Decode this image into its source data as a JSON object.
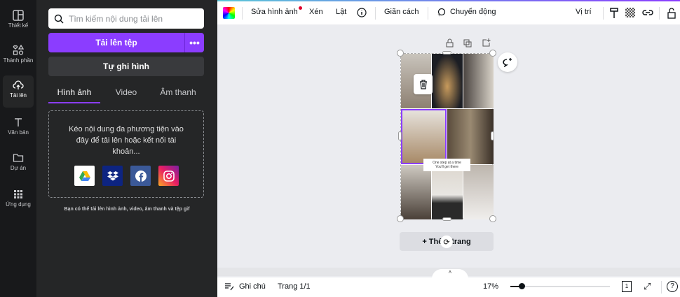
{
  "rail": {
    "items": [
      {
        "label": "Thiết kế",
        "icon": "layout-icon"
      },
      {
        "label": "Thành phần",
        "icon": "elements-icon"
      },
      {
        "label": "Tải lên",
        "icon": "cloud-upload-icon",
        "active": true
      },
      {
        "label": "Văn bản",
        "icon": "text-icon"
      },
      {
        "label": "Dự án",
        "icon": "folder-icon"
      },
      {
        "label": "Ứng dụng",
        "icon": "apps-grid-icon"
      }
    ]
  },
  "panel": {
    "search_placeholder": "Tìm kiếm nội dung tải lên",
    "upload_label": "Tải lên tệp",
    "more_label": "•••",
    "record_label": "Tự ghi hình",
    "tabs": [
      {
        "label": "Hình ảnh",
        "active": true
      },
      {
        "label": "Video"
      },
      {
        "label": "Âm thanh"
      }
    ],
    "drop_text": "Kéo nội dung đa phương tiện vào đây để tải lên hoặc kết nối tài khoản...",
    "services": [
      "google-drive",
      "dropbox",
      "facebook",
      "instagram"
    ],
    "note": "Bạn có thể tải lên hình ảnh, video, âm thanh và tệp gif"
  },
  "toolbar": {
    "edit_image": "Sửa hình ảnh",
    "crop": "Xén",
    "flip": "Lật",
    "spacing": "Giãn cách",
    "animate": "Chuyển động",
    "position": "Vị trí"
  },
  "canvas": {
    "text_box_line1": "One step at a time",
    "text_box_line2": "You'll get there",
    "add_page": "+ Thêm trang"
  },
  "bottom": {
    "notes": "Ghi chú",
    "page": "Trang 1/1",
    "zoom": "17%",
    "zoom_value": 17,
    "page_count": "1"
  },
  "colors": {
    "accent": "#8b3dff",
    "rail_bg": "#18191b",
    "panel_bg": "#252627"
  }
}
